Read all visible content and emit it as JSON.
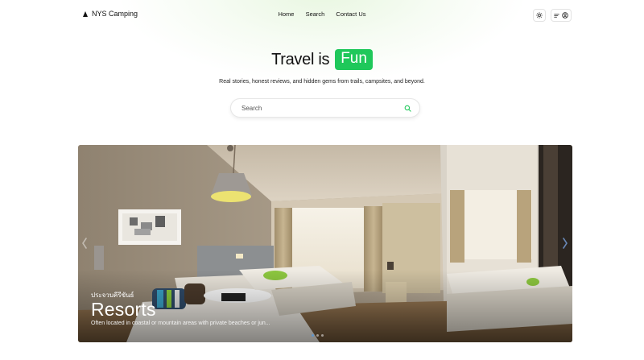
{
  "brand": {
    "name": "NYS Camping",
    "logo_icon": "triangle-logo-icon"
  },
  "nav": {
    "items": [
      "Home",
      "Search",
      "Contact Us"
    ]
  },
  "header_actions": {
    "theme_icon": "sun-icon",
    "menu_icon": "menu-icon",
    "account_icon": "user-circle-icon"
  },
  "hero": {
    "title_prefix": "Travel is",
    "title_highlight": "Fun",
    "subtitle": "Real stories, honest reviews, and hidden gems from trails, campsites, and beyond."
  },
  "search": {
    "placeholder": "Search",
    "icon": "search-icon"
  },
  "carousel": {
    "slide": {
      "location": "ประจวบคีรีขันธ์",
      "title": "Resorts",
      "description": "Often located in coastal or mountain areas with private beaches or jun..."
    },
    "prev_icon": "chevron-left-icon",
    "next_icon": "chevron-right-icon",
    "slide_count": 3,
    "active_index": 0
  },
  "colors": {
    "accent": "#1fc85a",
    "text": "#111111",
    "border": "#e3e3e3"
  }
}
